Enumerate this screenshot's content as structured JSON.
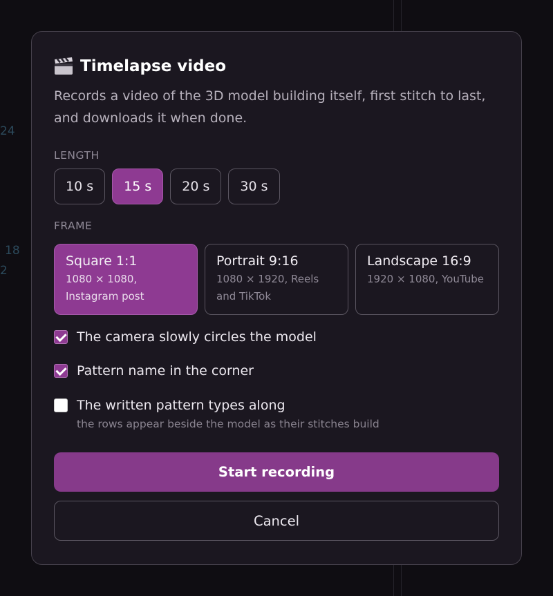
{
  "background": {
    "numbers": [
      "24",
      "18",
      "2"
    ]
  },
  "dialog": {
    "title": "Timelapse video",
    "title_icon": "clapperboard-icon",
    "subtitle": "Records a video of the 3D model building itself, first stitch to last, and downloads it when done.",
    "length": {
      "label": "LENGTH",
      "options": [
        "10 s",
        "15 s",
        "20 s",
        "30 s"
      ],
      "selected": "15 s"
    },
    "frame": {
      "label": "FRAME",
      "options": [
        {
          "name": "Square 1:1",
          "desc": "1080 × 1080, Instagram post"
        },
        {
          "name": "Portrait 9:16",
          "desc": "1080 × 1920, Reels and TikTok"
        },
        {
          "name": "Landscape 16:9",
          "desc": "1920 × 1080, YouTube"
        }
      ],
      "selected": "Square 1:1"
    },
    "options": [
      {
        "label": "The camera slowly circles the model",
        "checked": true
      },
      {
        "label": "Pattern name in the corner",
        "checked": true
      },
      {
        "label": "The written pattern types along",
        "sub": "the rows appear beside the model as their stitches build",
        "checked": false
      }
    ],
    "start_label": "Start recording",
    "cancel_label": "Cancel"
  },
  "colors": {
    "accent": "#8e3a92",
    "dialog_bg": "#1b1720",
    "page_bg": "#0f0d12"
  }
}
